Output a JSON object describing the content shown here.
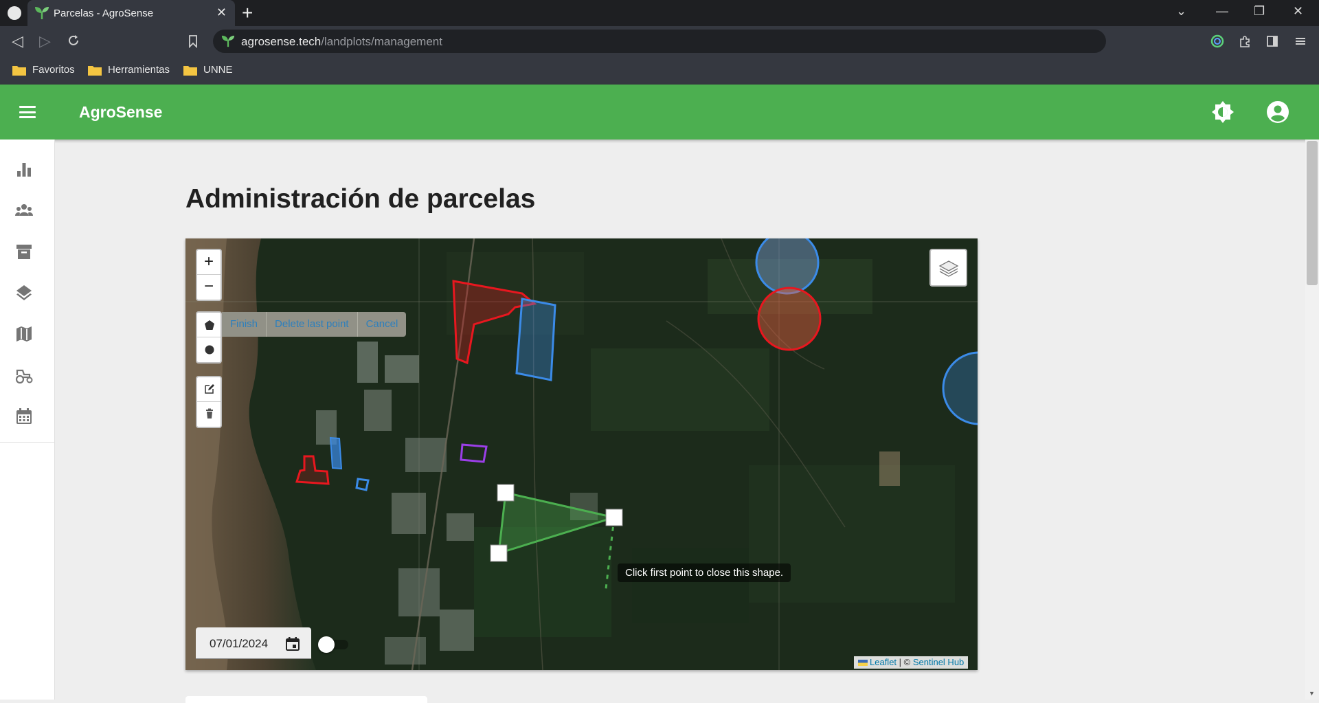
{
  "browser": {
    "tab_title": "Parcelas - AgroSense",
    "tab_close": "✕",
    "new_tab": "+",
    "url_domain": "agrosense.tech",
    "url_path": "/landplots/management",
    "bookmarks": [
      "Favoritos",
      "Herramientas",
      "UNNE"
    ]
  },
  "app": {
    "brand": "AgroSense",
    "page_title": "Administración de parcelas",
    "sidebar_items": [
      "dashboard",
      "users",
      "archive",
      "layers",
      "map",
      "tractor",
      "calendar"
    ]
  },
  "map": {
    "zoom_in": "+",
    "zoom_out": "−",
    "draw_actions": {
      "finish": "Finish",
      "delete_last": "Delete last point",
      "cancel": "Cancel"
    },
    "tooltip": "Click first point to close this shape.",
    "date_value": "07/01/2024",
    "attribution": {
      "leaflet": "Leaflet",
      "separator": " | © ",
      "sentinel": "Sentinel Hub"
    },
    "colors": {
      "red_parcel": "#e8171f",
      "blue_parcel": "#3b8be8",
      "purple_parcel": "#9b3fe8",
      "green_drawing": "#4caf50"
    }
  },
  "colors": {
    "appbar": "#4caf50",
    "page_bg": "#eeeeee"
  }
}
